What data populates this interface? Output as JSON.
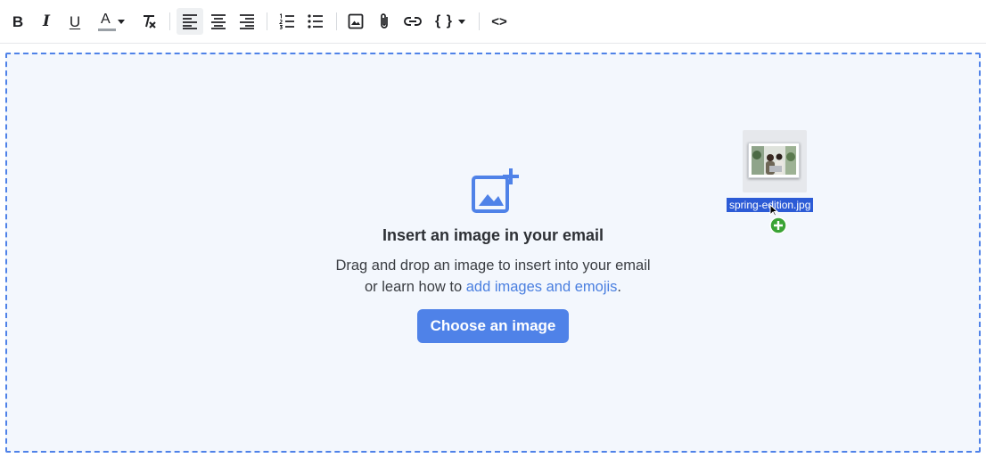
{
  "toolbar": {
    "bold": "B",
    "italic": "I",
    "underline": "U",
    "text_color": "A",
    "clear_format": "T",
    "code_braces": "{ }",
    "source": "<>",
    "colors": {
      "text_color_bar": "#9aa0a6",
      "active_bg": "#eef0f2"
    }
  },
  "dropzone": {
    "heading": "Insert an image in your email",
    "desc_line1": "Drag and drop an image to insert into your email",
    "desc_line2_prefix": "or learn how to ",
    "desc_link": "add images and emojis",
    "desc_line2_suffix": ".",
    "button_label": "Choose an image",
    "colors": {
      "accent": "#4f82e8",
      "background": "#f3f7fd"
    }
  },
  "drag": {
    "file_name": "spring-edition.jpg",
    "badge_color": "#3aa335"
  }
}
